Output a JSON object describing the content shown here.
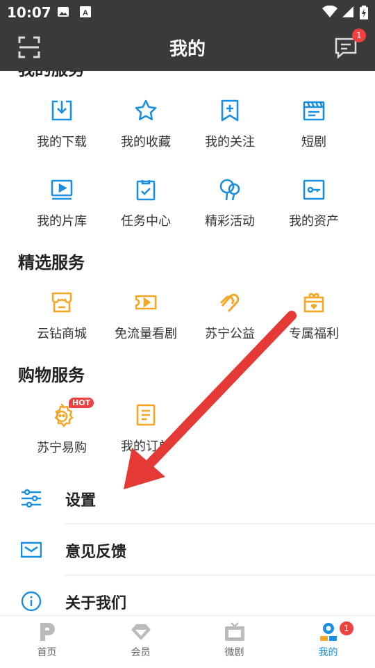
{
  "status_bar": {
    "time": "10:07"
  },
  "header": {
    "title": "我的",
    "message_badge": "1"
  },
  "my_services": {
    "title_partial": "我的服务",
    "items": [
      {
        "label": "我的下载",
        "icon": "download-icon"
      },
      {
        "label": "我的收藏",
        "icon": "star-icon"
      },
      {
        "label": "我的关注",
        "icon": "bookmark-plus-icon"
      },
      {
        "label": "短剧",
        "icon": "clapperboard-icon"
      },
      {
        "label": "我的片库",
        "icon": "video-library-icon"
      },
      {
        "label": "任务中心",
        "icon": "task-clipboard-icon"
      },
      {
        "label": "精彩活动",
        "icon": "balloons-icon"
      },
      {
        "label": "我的资产",
        "icon": "key-card-icon"
      }
    ]
  },
  "selected_services": {
    "title": "精选服务",
    "items": [
      {
        "label": "云钻商城",
        "icon": "shop-icon"
      },
      {
        "label": "免流量看剧",
        "icon": "free-traffic-ticket-icon"
      },
      {
        "label": "苏宁公益",
        "icon": "charity-heart-icon"
      },
      {
        "label": "专属福利",
        "icon": "gift-icon"
      }
    ]
  },
  "shopping_services": {
    "title": "购物服务",
    "items": [
      {
        "label": "苏宁易购",
        "icon": "suning-lion-icon",
        "badge": "HOT"
      },
      {
        "label": "我的订单",
        "icon": "order-document-icon"
      }
    ]
  },
  "settings_list": [
    {
      "label": "设置",
      "icon": "sliders-icon"
    },
    {
      "label": "意见反馈",
      "icon": "envelope-icon"
    },
    {
      "label": "关于我们",
      "icon": "info-icon"
    }
  ],
  "tabbar": {
    "tabs": [
      {
        "label": "首页",
        "icon": "home-logo-icon"
      },
      {
        "label": "会员",
        "icon": "diamond-icon"
      },
      {
        "label": "微剧",
        "icon": "tv-icon"
      },
      {
        "label": "我的",
        "icon": "profile-icon",
        "badge": "1",
        "active": true
      }
    ]
  },
  "colors": {
    "accent": "#1a8fe0",
    "service_orange": "#f5a623",
    "badge_red": "#f04040",
    "header_bg": "#3a3a3a",
    "arrow_red": "#e53935"
  }
}
